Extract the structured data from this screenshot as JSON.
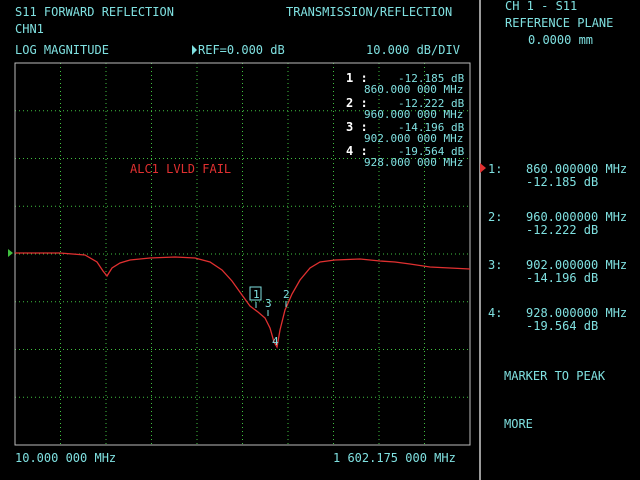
{
  "header": {
    "title": "S11 FORWARD REFLECTION",
    "mode": "TRANSMISSION/REFLECTION",
    "channel": "CHN1",
    "format": "LOG MAGNITUDE",
    "ref": "REF=0.000 dB",
    "scale": "10.000 dB/DIV"
  },
  "footer": {
    "start_freq": "10.000 000 MHz",
    "stop_freq": "1 602.175 000 MHz"
  },
  "alert": "ALC1 LVLD FAIL",
  "readouts": [
    {
      "id": "1 :",
      "value": "-12.185 dB",
      "freq": "860.000 000 MHz"
    },
    {
      "id": "2 :",
      "value": "-12.222 dB",
      "freq": "960.000 000 MHz"
    },
    {
      "id": "3 :",
      "value": "-14.196 dB",
      "freq": "902.000 000 MHz"
    },
    {
      "id": "4 :",
      "value": "-19.564 dB",
      "freq": "928.000 000 MHz"
    }
  ],
  "trace_labels": [
    "1",
    "3",
    "2",
    "4"
  ],
  "side": {
    "line1": "CH 1 - S11",
    "line2": "REFERENCE PLANE",
    "line3": "0.0000 mm",
    "markers": [
      {
        "num": "1:",
        "freq": "860.000000 MHz",
        "value": "-12.185 dB",
        "active": true
      },
      {
        "num": "2:",
        "freq": "960.000000 MHz",
        "value": "-12.222 dB",
        "active": false
      },
      {
        "num": "3:",
        "freq": "902.000000 MHz",
        "value": "-14.196 dB",
        "active": false
      },
      {
        "num": "4:",
        "freq": "928.000000 MHz",
        "value": "-19.564 dB",
        "active": false
      }
    ],
    "softkeys": [
      "MARKER TO PEAK",
      "MORE"
    ]
  },
  "colors": {
    "trace": "#e03030",
    "text": "#7fe0e0",
    "grid": "#40c040",
    "alert": "#e03030"
  }
}
